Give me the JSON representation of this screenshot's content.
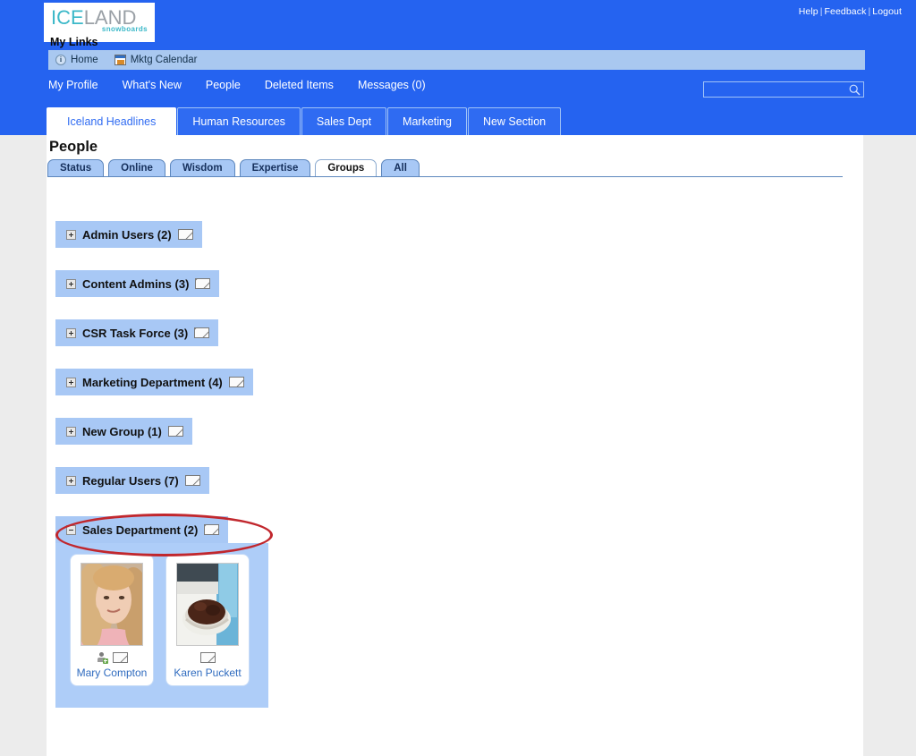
{
  "header": {
    "logo": {
      "part1": "ICE",
      "part2": "LAND",
      "tagline": "snowboards"
    },
    "util": {
      "help": "Help",
      "feedback": "Feedback",
      "logout": "Logout",
      "separator": "|"
    },
    "my_links_label": "My Links",
    "link_bar": [
      {
        "label": "Home",
        "icon": "info-icon"
      },
      {
        "label": "Mktg Calendar",
        "icon": "calendar-icon"
      }
    ],
    "nav": [
      {
        "label": "My Profile"
      },
      {
        "label": "What's New"
      },
      {
        "label": "People"
      },
      {
        "label": "Deleted Items"
      },
      {
        "label": "Messages (0)"
      }
    ],
    "search": {
      "value": "",
      "placeholder": "",
      "icon": "search-icon"
    },
    "section_tabs": [
      {
        "label": "Iceland Headlines",
        "active": true
      },
      {
        "label": "Human Resources",
        "active": false
      },
      {
        "label": "Sales Dept",
        "active": false
      },
      {
        "label": "Marketing",
        "active": false
      },
      {
        "label": "New Section",
        "active": false
      }
    ]
  },
  "main": {
    "title": "People",
    "sub_tabs": [
      {
        "label": "Status",
        "active": false
      },
      {
        "label": "Online",
        "active": false
      },
      {
        "label": "Wisdom",
        "active": false
      },
      {
        "label": "Expertise",
        "active": false
      },
      {
        "label": "Groups",
        "active": true
      },
      {
        "label": "All",
        "active": false
      }
    ],
    "groups": [
      {
        "name": "Admin Users (2)",
        "expanded": false,
        "expander": "plus",
        "mail_icon": "envelope-icon"
      },
      {
        "name": "Content Admins (3)",
        "expanded": false,
        "expander": "plus",
        "mail_icon": "envelope-icon"
      },
      {
        "name": "CSR Task Force (3)",
        "expanded": false,
        "expander": "plus",
        "mail_icon": "envelope-icon"
      },
      {
        "name": "Marketing Department (4)",
        "expanded": false,
        "expander": "plus",
        "mail_icon": "envelope-icon"
      },
      {
        "name": "New Group (1)",
        "expanded": false,
        "expander": "plus",
        "mail_icon": "envelope-icon"
      },
      {
        "name": "Regular Users (7)",
        "expanded": false,
        "expander": "plus",
        "mail_icon": "envelope-icon"
      },
      {
        "name": "Sales Department (2)",
        "expanded": true,
        "expander": "minus",
        "mail_icon": "envelope-icon"
      }
    ],
    "expanded_group_members": [
      {
        "name": "Mary Compton",
        "icons": [
          "add-contact-icon",
          "envelope-icon"
        ]
      },
      {
        "name": "Karen Puckett",
        "icons": [
          "envelope-icon"
        ]
      }
    ]
  },
  "annotation": {
    "shape": "ellipse",
    "color": "#c1272d",
    "targets": "Sales Department (2)"
  },
  "colors": {
    "header_blue": "#2563f0",
    "tab_blue": "#2f6bf2",
    "panel_blue": "#a8c8f5",
    "members_blue": "#aecdf8",
    "link_text": "#2f6bbf",
    "page_bg": "#ececec",
    "annotation_red": "#c1272d"
  }
}
